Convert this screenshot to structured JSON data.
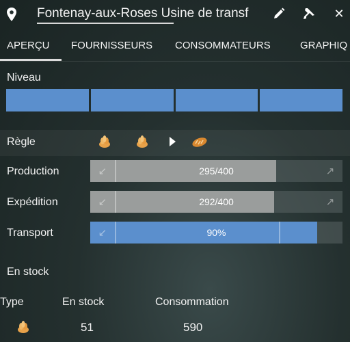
{
  "header": {
    "title": "Fontenay-aux-Roses Usine de transf",
    "icons": [
      "map-pin-icon",
      "edit-pencil-icon",
      "pin-icon",
      "close-icon"
    ]
  },
  "tabs": [
    {
      "label": "APERÇU",
      "active": true
    },
    {
      "label": "FOURNISSEURS",
      "active": false
    },
    {
      "label": "CONSOMMATEURS",
      "active": false
    },
    {
      "label": "GRAPHIQ",
      "active": false
    }
  ],
  "niveau": {
    "label": "Niveau",
    "segments": 4,
    "filled": 4,
    "color": "#5b8fcd"
  },
  "regle": {
    "label": "Règle",
    "icons": [
      "grain-icon",
      "grain-icon",
      "play-arrow-icon",
      "bread-icon"
    ]
  },
  "production": {
    "label": "Production",
    "text": "295/400",
    "fraction": 0.7375
  },
  "expedition": {
    "label": "Expédition",
    "text": "292/400",
    "fraction": 0.73
  },
  "transport": {
    "label": "Transport",
    "text": "90%",
    "fraction": 0.9,
    "color": "#5b8fcd"
  },
  "stock": {
    "title": "En stock",
    "headers": {
      "type": "Type",
      "stock": "En stock",
      "consumption": "Consommation"
    },
    "rows": [
      {
        "type_icon": "grain-icon",
        "stock": "51",
        "consumption": "590"
      }
    ]
  }
}
